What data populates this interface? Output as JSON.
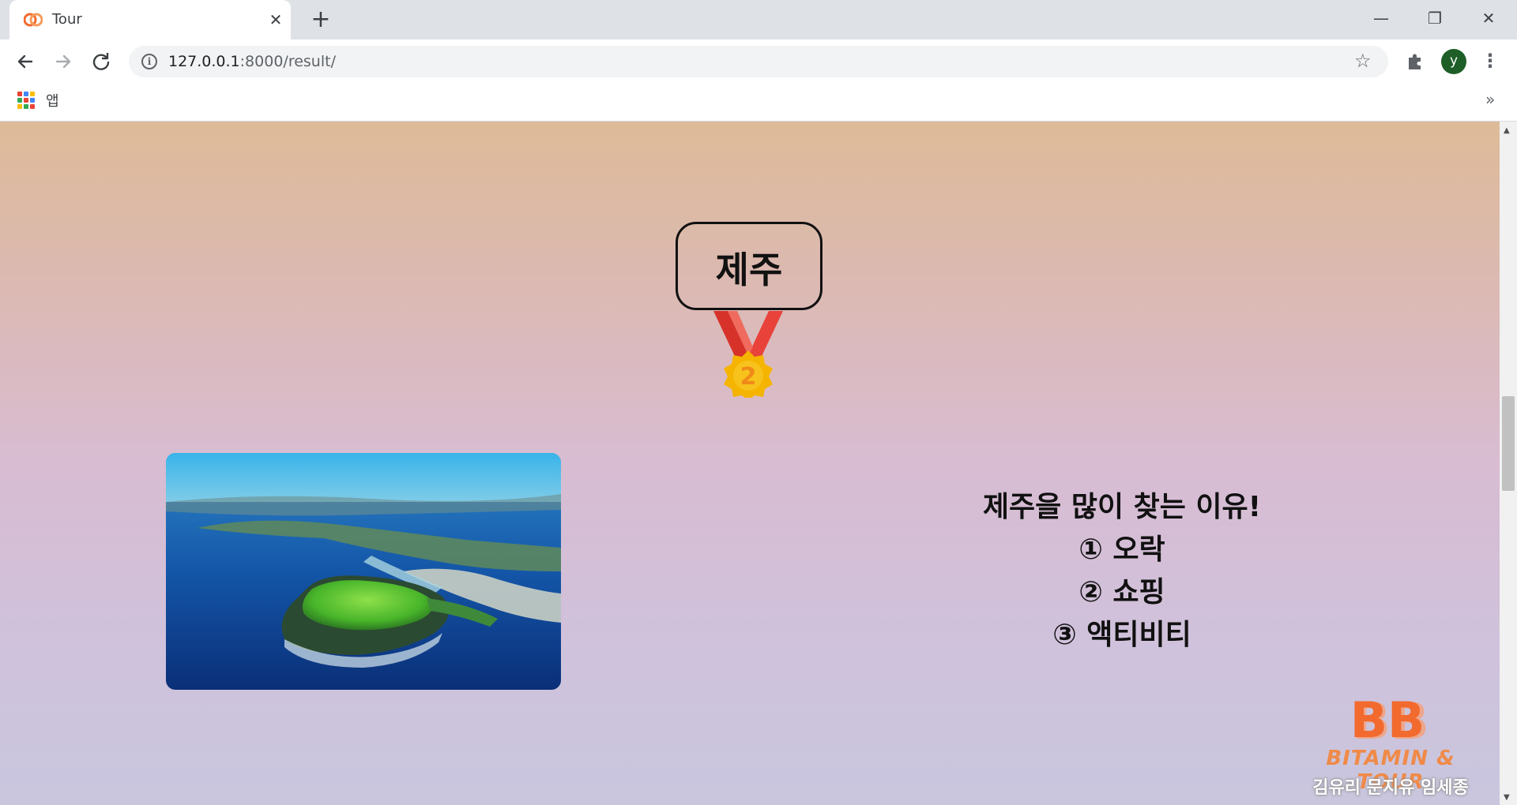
{
  "browser": {
    "tab_title": "Tour",
    "tab_close": "✕",
    "new_tab": "+",
    "url_host": "127.0.0.1",
    "url_rest": ":8000/result/",
    "avatar_initial": "y",
    "bookmarks": {
      "apps_label": "앱",
      "more": "»"
    },
    "icons": [
      "back-arrow-icon",
      "forward-arrow-icon",
      "reload-icon",
      "info-icon",
      "star-icon",
      "puzzle-icon",
      "kebab-menu-icon",
      "apps-grid-icon"
    ],
    "window_controls": {
      "minimize": "—",
      "restore": "❐",
      "close": "✕"
    }
  },
  "result": {
    "destination": "제주",
    "rank": "2",
    "reasons_title": "제주을 많이 찾는 이유!",
    "reasons": [
      "① 오락",
      "② 쇼핑",
      "③ 액티비티"
    ]
  },
  "footer_logo": {
    "mark": "BB",
    "name": "BITAMIN & TOUR",
    "credit": "김유리 문지유 임세종"
  },
  "colors": {
    "accent_orange": "#f08a48",
    "avatar_green": "#1e5e27",
    "gradient_top": "#ddbb98",
    "gradient_bottom": "#c9c6de"
  }
}
